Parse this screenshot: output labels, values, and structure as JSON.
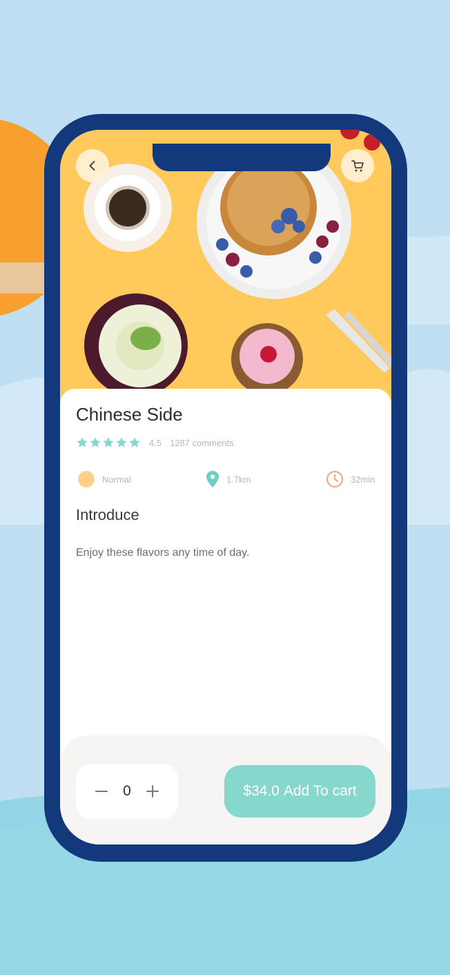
{
  "product": {
    "title": "Chinese Side",
    "rating": "4.5",
    "comments": "1287 comments",
    "stars": 5
  },
  "info": {
    "level": "Normal",
    "distance": "1.7km",
    "time": "32min"
  },
  "section": {
    "title": "Introduce",
    "description": "Enjoy these flavors any time of day."
  },
  "cart": {
    "quantity": "0",
    "price": "$34.0",
    "button_label": "Add To cart"
  },
  "icons": {
    "back": "chevron-left-icon",
    "cart": "cart-icon",
    "star": "star-icon",
    "level": "circle-icon",
    "distance": "location-pin-icon",
    "time": "clock-icon",
    "minus": "minus-icon",
    "plus": "plus-icon"
  },
  "colors": {
    "accent": "#86d8cd",
    "phone_frame": "#13387c",
    "hero_bg": "#ffc95b",
    "level_dot": "#ffd18a",
    "clock": "#f2a98a"
  }
}
